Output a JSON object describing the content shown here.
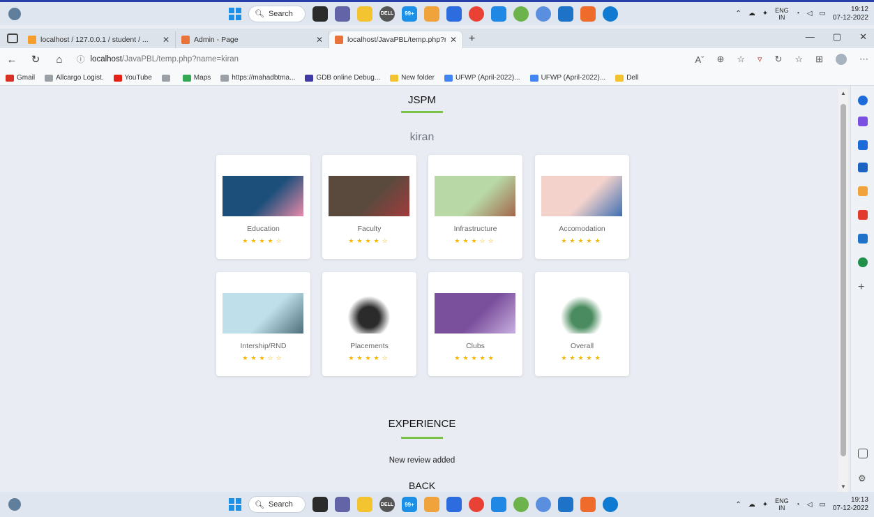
{
  "taskbar": {
    "search_label": "Search",
    "lang_line1": "ENG",
    "lang_line2": "IN",
    "top_time": "19:12",
    "top_date": "07-12-2022",
    "bottom_time": "19:13",
    "bottom_date": "07-12-2022",
    "badge": "99+"
  },
  "tabs": [
    {
      "title": "localhost / 127.0.0.1 / student / ..."
    },
    {
      "title": "Admin - Page"
    },
    {
      "title": "localhost/JavaPBL/temp.php?nar"
    }
  ],
  "address": {
    "host": "localhost",
    "path": "/JavaPBL/temp.php?name=kiran"
  },
  "bookmarks": [
    {
      "label": "Gmail",
      "color": "#d93025"
    },
    {
      "label": "Allcargo Logist.",
      "color": "#9aa0a6"
    },
    {
      "label": "YouTube",
      "color": "#e62117"
    },
    {
      "label": "",
      "color": "#9aa0a6"
    },
    {
      "label": "Maps",
      "color": "#34a853"
    },
    {
      "label": "https://mahadbtma...",
      "color": "#9aa0a6"
    },
    {
      "label": "GDB online Debug...",
      "color": "#3e3aa6"
    },
    {
      "label": "New folder",
      "color": "#f4c430"
    },
    {
      "label": "UFWP (April-2022)...",
      "color": "#4285f4"
    },
    {
      "label": "UFWP (April-2022)...",
      "color": "#4285f4"
    },
    {
      "label": "Dell",
      "color": "#f4c430"
    }
  ],
  "page": {
    "title": "JSPM",
    "username": "kiran",
    "experience_title": "EXPERIENCE",
    "review_text": "New review added",
    "back_label": "BACK"
  },
  "cards": [
    {
      "label": "Education",
      "rating": 4,
      "bg": "#1c4f7a",
      "accent": "#e98aa8"
    },
    {
      "label": "Faculty",
      "rating": 4,
      "bg": "#5a4a3e",
      "accent": "#a23b3b"
    },
    {
      "label": "Infrastructure",
      "rating": 3,
      "bg": "#b8d8a6",
      "accent": "#a2664a"
    },
    {
      "label": "Accomodation",
      "rating": 5,
      "bg": "#f3d2cc",
      "accent": "#3f6fb2"
    },
    {
      "label": "Intership/RND",
      "rating": 3,
      "bg": "#bfe0ea",
      "accent": "#4d6e7a"
    },
    {
      "label": "Placements",
      "rating": 4,
      "bg": "#ffffff",
      "accent": "#2b2b2b"
    },
    {
      "label": "Clubs",
      "rating": 5,
      "bg": "#7a4f9c",
      "accent": "#c9b0e0"
    },
    {
      "label": "Overall",
      "rating": 5,
      "bg": "#ffffff",
      "accent": "#4a8c5f"
    }
  ]
}
